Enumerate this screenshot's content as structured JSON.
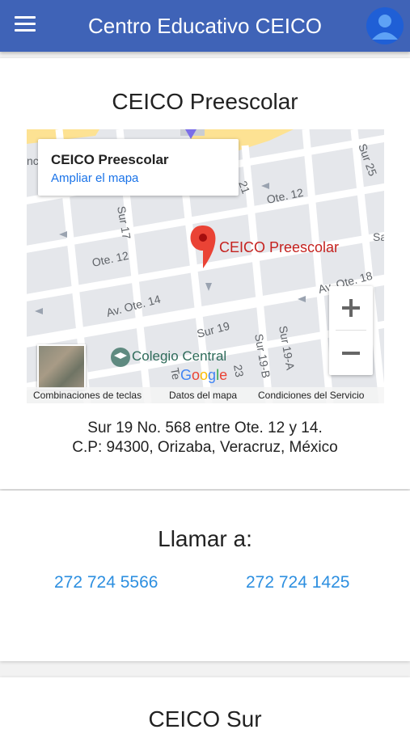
{
  "appbar": {
    "title": "Centro Educativo CEICO"
  },
  "location_card": {
    "title": "CEICO Preescolar",
    "map": {
      "info_name": "CEICO Preescolar",
      "info_link": "Ampliar el mapa",
      "pin_label": "CEICO Preescolar",
      "college_label": "Colegio Central",
      "google_logo": "Google",
      "street_labels": [
        "Ote. 12",
        "Ote. 12",
        "Av. Ote. 14",
        "Av. Ote. 18",
        "Sur 19",
        "Sur 17",
        "Sur 19-B",
        "Sur 19-A",
        "Sur 25",
        "21",
        "23",
        "Te",
        "nc",
        "Sa"
      ],
      "footer": {
        "shortcuts": "Combinaciones de teclas",
        "map_data": "Datos del mapa",
        "terms": "Condiciones del Servicio"
      },
      "zoom_in": "+",
      "zoom_out": "−"
    },
    "address_line1": "Sur 19 No. 568 entre Ote. 12 y 14.",
    "address_line2": "C.P: 94300, Orizaba, Veracruz, México"
  },
  "call_card": {
    "title": "Llamar a:",
    "phone1": "272 724 5566",
    "phone2": "272 724 1425"
  },
  "next_card": {
    "title": "CEICO Sur"
  },
  "colors": {
    "appbar": "#3f63b7",
    "link": "#2d8fe0",
    "pin": "#ea4335"
  }
}
